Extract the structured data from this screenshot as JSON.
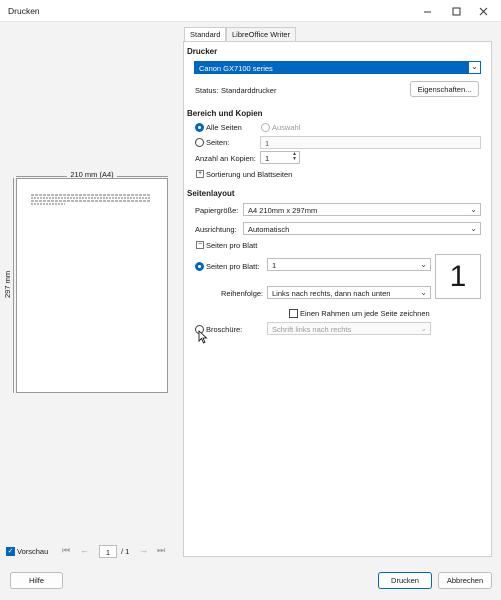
{
  "window": {
    "title": "Drucken"
  },
  "preview": {
    "width_label": "210 mm (A4)",
    "height_label": "297 mm",
    "show_preview_label": "Vorschau",
    "page_input": "1",
    "page_total": "/ 1"
  },
  "tabs": [
    {
      "label": "Standard"
    },
    {
      "label": "LibreOffice Writer"
    }
  ],
  "printer": {
    "section": "Drucker",
    "selected": "Canon GX7100 series",
    "status_label": "Status:",
    "status_value": "Standarddrucker",
    "properties_button": "Eigenschaften..."
  },
  "range": {
    "section": "Bereich und Kopien",
    "all_pages": "Alle Seiten",
    "selection": "Auswahl",
    "pages_label": "Seiten:",
    "pages_value": "1",
    "copies_label": "Anzahl an Kopien:",
    "copies_value": "1",
    "collation_label": "Sortierung und Blattseiten"
  },
  "layout": {
    "section": "Seitenlayout",
    "paper_label": "Papiergröße:",
    "paper_value": "A4 210mm x 297mm",
    "orientation_label": "Ausrichtung:",
    "orientation_value": "Automatisch",
    "pages_per_sheet_expander": "Seiten pro Blatt",
    "pages_per_sheet_label": "Seiten pro Blatt:",
    "pages_per_sheet_value": "1",
    "pages_per_sheet_preview": "1",
    "order_label": "Reihenfolge:",
    "order_value": "Links nach rechts, dann nach unten",
    "border_label": "Einen Rahmen um jede Seite zeichnen",
    "brochure_label": "Broschüre:",
    "brochure_value": "Schrift links nach rechts"
  },
  "footer": {
    "help": "Hilfe",
    "print": "Drucken",
    "cancel": "Abbrechen"
  },
  "colors": {
    "accent": "#0067c0"
  }
}
